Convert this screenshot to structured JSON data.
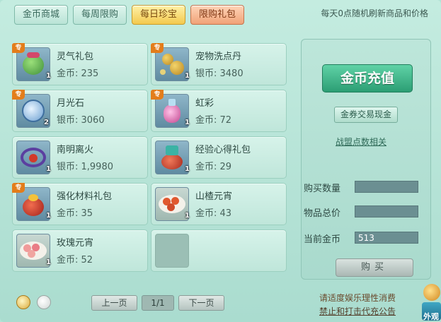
{
  "tabs": [
    "金币商城",
    "每周限购",
    "每日珍宝",
    "限购礼包"
  ],
  "notice": "每天0点随机刷新商品和价格",
  "items": [
    {
      "name": "灵气礼包",
      "price": "金币: 235",
      "badge": "专",
      "qty": "1"
    },
    {
      "name": "宠物洗点丹",
      "price": "银币: 3480",
      "badge": "专",
      "qty": "1"
    },
    {
      "name": "月光石",
      "price": "银币: 3060",
      "badge": "专",
      "qty": "2"
    },
    {
      "name": "虹彩",
      "price": "金币: 72",
      "badge": "专",
      "qty": "1"
    },
    {
      "name": "南明离火",
      "price": "银币: 1,9980",
      "badge": "",
      "qty": "1"
    },
    {
      "name": "经验心得礼包",
      "price": "金币: 29",
      "badge": "",
      "qty": "1"
    },
    {
      "name": "强化材料礼包",
      "price": "金币: 35",
      "badge": "专",
      "qty": "1"
    },
    {
      "name": "山楂元宵",
      "price": "金币: 43",
      "badge": "",
      "qty": "1"
    },
    {
      "name": "玫瑰元宵",
      "price": "金币: 52",
      "badge": "",
      "qty": "1"
    }
  ],
  "side": {
    "topup": "金币充值",
    "voucher": "金券交易现金",
    "league": "战盟点数相关",
    "qty_label": "购买数量",
    "qty_value": "",
    "total_label": "物品总价",
    "total_value": "",
    "gold_label": "当前金币",
    "gold_value": "513",
    "buy": "购买"
  },
  "pager": {
    "prev": "上一页",
    "page": "1/1",
    "next": "下一页"
  },
  "footer": {
    "line1": "请适度娱乐理性消费",
    "line2": "禁止和打击代充公告",
    "corner": "外观"
  }
}
